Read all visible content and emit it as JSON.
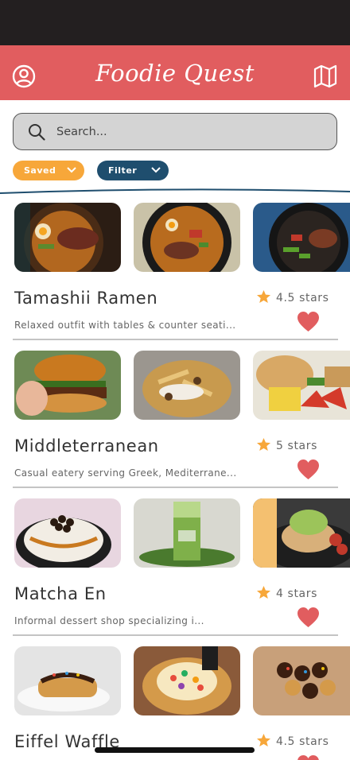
{
  "app": {
    "title": "Foodie Quest",
    "brand_color": "#e15d5f",
    "status_bar_color": "#231f20"
  },
  "header": {
    "left_icon": "profile-icon",
    "right_icon": "map-icon"
  },
  "search": {
    "placeholder": "Search...",
    "value": "",
    "icon": "search-icon"
  },
  "chips": [
    {
      "label": "Saved",
      "color": "#f7a73a",
      "icon": "chevron-down-icon"
    },
    {
      "label": "Filter",
      "color": "#1f4e6e",
      "icon": "chevron-down-icon"
    }
  ],
  "listings": [
    {
      "name": "Tamashii Ramen",
      "rating": "4.5 stars",
      "description": "Relaxed outfit with tables & counter seati...",
      "favorited": true,
      "photos": [
        "ramen-bowl-photo",
        "ramen-bowl-photo",
        "ramen-bowl-photo"
      ]
    },
    {
      "name": "Middleterranean",
      "rating": "5 stars",
      "description": "Casual eatery serving Greek, Mediterrane...",
      "favorited": true,
      "photos": [
        "burger-photo",
        "loaded-fries-photo",
        "salad-plate-photo"
      ]
    },
    {
      "name": "Matcha En",
      "rating": "4 stars",
      "description": "Informal dessert shop specializing i...",
      "favorited": true,
      "photos": [
        "boba-dessert-photo",
        "matcha-drink-photo",
        "matcha-pancake-photo"
      ]
    },
    {
      "name": "Eiffel Waffle",
      "rating": "4.5 stars",
      "description": "",
      "favorited": true,
      "photos": [
        "waffle-dessert-photo",
        "waffle-sundae-photo",
        "bubble-waffle-photo"
      ]
    }
  ],
  "colors": {
    "star": "#f7a73a",
    "heart": "#e15d5f",
    "divider": "#1f4e6e"
  }
}
